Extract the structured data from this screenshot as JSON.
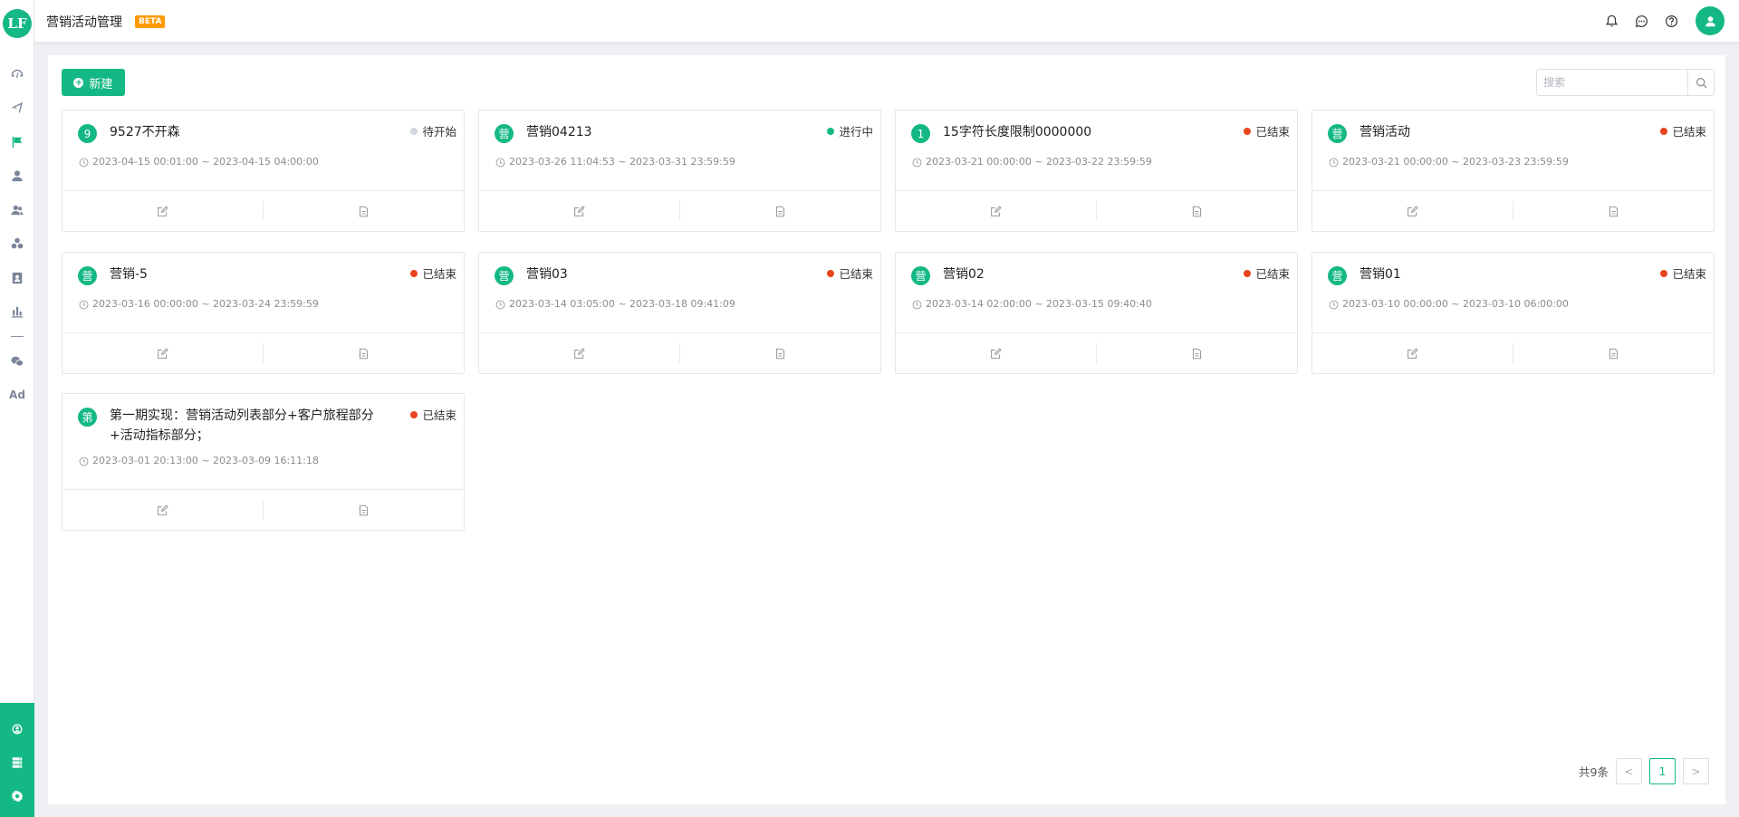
{
  "app": {
    "logo_text": "LF",
    "page_title": "营销活动管理",
    "beta_label": "BETA"
  },
  "colors": {
    "brand": "#14b884",
    "status_pending": "#d3d7de",
    "status_running": "#14b884",
    "status_ended": "#e8441d"
  },
  "sidebar": {
    "items": [
      {
        "icon": "dashboard-icon"
      },
      {
        "icon": "send-icon"
      },
      {
        "icon": "flag-icon"
      },
      {
        "icon": "user-icon"
      },
      {
        "icon": "user-group-icon"
      },
      {
        "icon": "cluster-icon"
      },
      {
        "icon": "contact-book-icon"
      },
      {
        "icon": "bar-chart-icon"
      },
      {
        "icon": "wechat-icon"
      }
    ],
    "ad_label": "Ad",
    "bottom_items": [
      {
        "icon": "hub-icon"
      },
      {
        "icon": "storage-icon"
      },
      {
        "icon": "settings-icon"
      }
    ]
  },
  "header": {
    "icons": [
      "bell-icon",
      "message-icon",
      "help-icon",
      "avatar-user-icon"
    ]
  },
  "toolbar": {
    "new_label": "新建",
    "search_placeholder": "搜索"
  },
  "cards": [
    {
      "badge": "9",
      "title": "9527不开森",
      "status": "待开始",
      "status_type": "pending",
      "time": "2023-04-15 00:01:00 ~ 2023-04-15 04:00:00"
    },
    {
      "badge": "营",
      "title": "营销04213",
      "status": "进行中",
      "status_type": "running",
      "time": "2023-03-26 11:04:53 ~ 2023-03-31 23:59:59"
    },
    {
      "badge": "1",
      "title": "15字符长度限制0000000",
      "status": "已结束",
      "status_type": "ended",
      "time": "2023-03-21 00:00:00 ~ 2023-03-22 23:59:59"
    },
    {
      "badge": "营",
      "title": "营销活动",
      "status": "已结束",
      "status_type": "ended",
      "time": "2023-03-21 00:00:00 ~ 2023-03-23 23:59:59"
    },
    {
      "badge": "营",
      "title": "营销-5",
      "status": "已结束",
      "status_type": "ended",
      "time": "2023-03-16 00:00:00 ~ 2023-03-24 23:59:59"
    },
    {
      "badge": "营",
      "title": "营销03",
      "status": "已结束",
      "status_type": "ended",
      "time": "2023-03-14 03:05:00 ~ 2023-03-18 09:41:09"
    },
    {
      "badge": "营",
      "title": "营销02",
      "status": "已结束",
      "status_type": "ended",
      "time": "2023-03-14 02:00:00 ~ 2023-03-15 09:40:40"
    },
    {
      "badge": "营",
      "title": "营销01",
      "status": "已结束",
      "status_type": "ended",
      "time": "2023-03-10 00:00:00 ~ 2023-03-10 06:00:00"
    },
    {
      "badge": "第",
      "title": "第一期实现：营销活动列表部分+客户旅程部分+活动指标部分；",
      "status": "已结束",
      "status_type": "ended",
      "time": "2023-03-01 20:13:00 ~ 2023-03-09 16:11:18"
    }
  ],
  "pagination": {
    "total_text": "共9条",
    "prev": "<",
    "next": ">",
    "pages": [
      "1"
    ],
    "current": "1"
  }
}
